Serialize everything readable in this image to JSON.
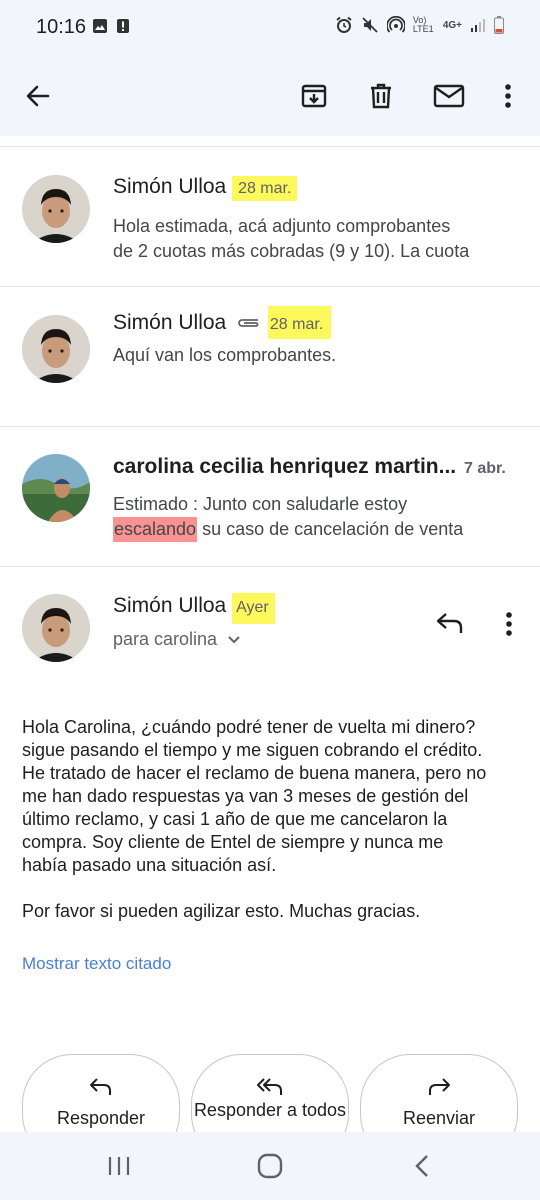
{
  "status_bar": {
    "time": "10:16",
    "network_label": "Vo) LTE1",
    "network_type": "4G+",
    "icons": [
      "image-icon",
      "alert-icon",
      "alarm-icon",
      "mute-icon",
      "hotspot-icon",
      "signal-icon",
      "battery-icon"
    ]
  },
  "toolbar": {
    "icons": [
      "back-arrow-icon",
      "archive-icon",
      "delete-icon",
      "mark-unread-icon",
      "more-vert-icon"
    ]
  },
  "messages": [
    {
      "sender": "Simón Ulloa",
      "date": "28 mar.",
      "snippet_lines": [
        "Hola estimada, acá adjunto comprobantes",
        "de 2 cuotas más cobradas (9 y 10). La cuota"
      ]
    },
    {
      "sender": "Simón Ulloa",
      "date": "28 mar.",
      "has_attachment": true,
      "snippet_lines": [
        "Aquí van los comprobantes."
      ]
    },
    {
      "sender": "carolina cecilia henriquez martin...",
      "date": "7 abr.",
      "snippet_line1": "Estimado : Junto con saludarle estoy",
      "snippet_highlight": "escalando",
      "snippet_line2_rest": " su caso de cancelación de venta"
    }
  ],
  "open_message": {
    "sender": "Simón Ulloa",
    "date": "Ayer",
    "recipient": "para carolina",
    "body_paragraphs": [
      "Hola Carolina, ¿cuándo podré tener de vuelta mi dinero?\nsigue pasando el tiempo y me siguen cobrando el crédito.\nHe tratado de hacer el reclamo de buena manera, pero no\nme han dado respuestas ya van 3 meses de gestión del\núltimo reclamo, y casi 1 año de que me cancelaron la\ncompra. Soy cliente de Entel de siempre y nunca me\nhabía pasado una situación así.",
      "Por favor si pueden agilizar esto. Muchas gracias."
    ],
    "show_quoted": "Mostrar texto citado"
  },
  "actions": {
    "reply": "Responder",
    "reply_all": "Responder a todos",
    "forward": "Reenviar"
  },
  "colors": {
    "highlight_yellow": "#fdf85c",
    "highlight_red": "#f99393",
    "link": "#4a7fd6",
    "bar_bg": "#f2f6fc"
  }
}
